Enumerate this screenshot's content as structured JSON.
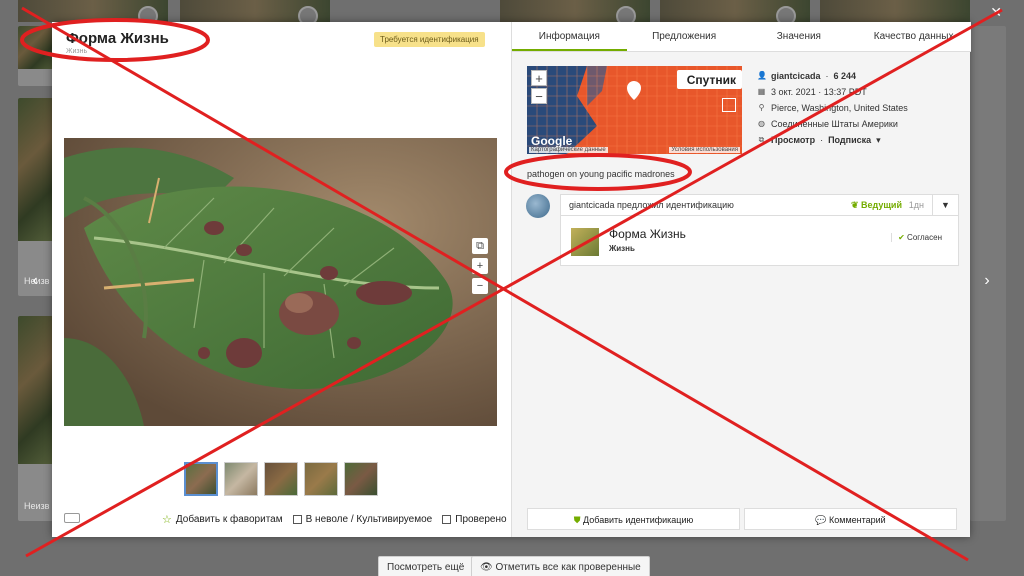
{
  "modal": {
    "title": "Форма Жизнь",
    "subtitle": "Жизнь",
    "needs_id_badge": "Требуется идентификация",
    "close_icon": "close-icon"
  },
  "left_actions": {
    "favorite": "Добавить к фаворитам",
    "captive": "В неволе / Культивируемое",
    "reviewed": "Проверено"
  },
  "tabs": [
    "Информация",
    "Предложения",
    "Значения",
    "Качество данных"
  ],
  "map": {
    "layer_label": "Спутник",
    "logo": "Google",
    "terms": "Условия использования",
    "data_label": "Картографические данные"
  },
  "meta": {
    "user": "giantcicada",
    "observation_count": "6 244",
    "date": "3 окт. 2021 · 13:37 PDT",
    "place": "Pierce, Washington, United States",
    "country": "Соединенные Штаты Америки",
    "view_label": "Просмотр",
    "subscribe_label": "Подписка"
  },
  "description": "pathogen on young pacific madrones",
  "identification": {
    "header": "giantcicada предложил идентификацию",
    "leading": "Ведущий",
    "age": "1дн",
    "taxon_name": "Форма Жизнь",
    "common_name": "Жизнь",
    "agree": "Согласен"
  },
  "right_buttons": {
    "add_id": "Добавить идентификацию",
    "comment": "Комментарий"
  },
  "background": {
    "card_caption": "Неизв",
    "load_more": "Посмотреть ещё",
    "mark_reviewed": "Отметить все как проверенные"
  },
  "colors": {
    "accent": "#74ac00",
    "annotation_red": "#e02020",
    "needs_id_bg": "#f7e18a"
  }
}
